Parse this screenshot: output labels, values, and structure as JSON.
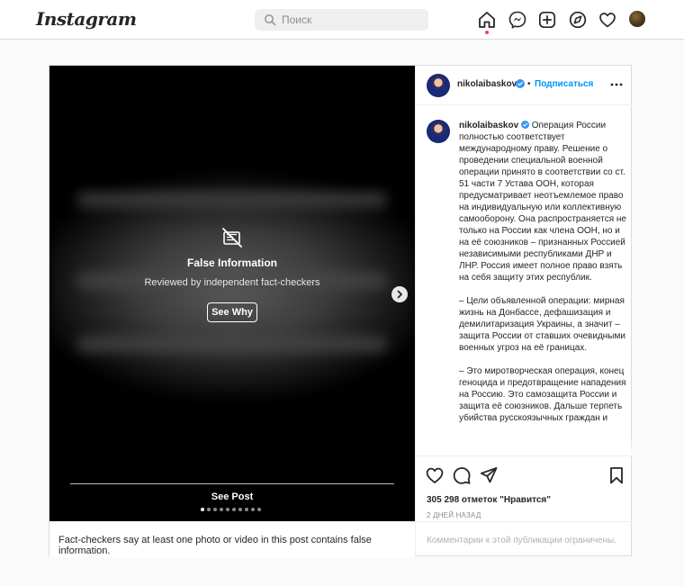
{
  "header": {
    "logo": "Instagram",
    "search_placeholder": "Поиск",
    "nav_icons": [
      "home-icon",
      "messenger-icon",
      "new-post-icon",
      "explore-icon",
      "activity-heart-icon",
      "profile-avatar"
    ],
    "active_indicator_color": "#ed4956"
  },
  "post": {
    "media": {
      "overlay_title": "False Information",
      "overlay_subtitle": "Reviewed by independent fact-checkers",
      "see_why_label": "See Why",
      "see_post_label": "See Post",
      "carousel_count": 10,
      "carousel_active_index": 0
    },
    "fact_check_notice": "Fact-checkers say at least one photo or video in this post contains false information.",
    "author": {
      "username": "nikolaibaskov",
      "verified": true,
      "follow_label": "Подписаться",
      "separator": "•"
    },
    "caption": {
      "username": "nikolaibaskov",
      "paragraphs": [
        "Операция России полностью соответствует международному праву. Решение о проведении специальной военной операции принято в соответствии со ст. 51 части 7 Устава ООН, которая предусматривает неотъемлемое право на индивидуальную или коллективную самооборону. Она распространяется не только на России как члена ООН, но и на её союзников – признанных Россией независимыми республиками ДНР и ЛНР. Россия имеет полное право взять на себя защиту этих республик.",
        "– Цели объявленной операции: мирная жизнь на Донбассе, дефашизация и демилитаризация Украины, а значит – защита России от ставших очевидными военных угроз на её границах.",
        "– Это миротворческая операция, конец геноцида и предотвращение нападения на Россию. Это самозащита России и защита её союзников. Дальше терпеть убийства русскоязычных граждан и"
      ]
    },
    "likes": "305 298 отметок \"Нравится\"",
    "timestamp": "2 ДНЕЙ НАЗАД",
    "comments_disabled": "Комментарии к этой публикации ограничены.",
    "accent_color": "#0095f6"
  }
}
